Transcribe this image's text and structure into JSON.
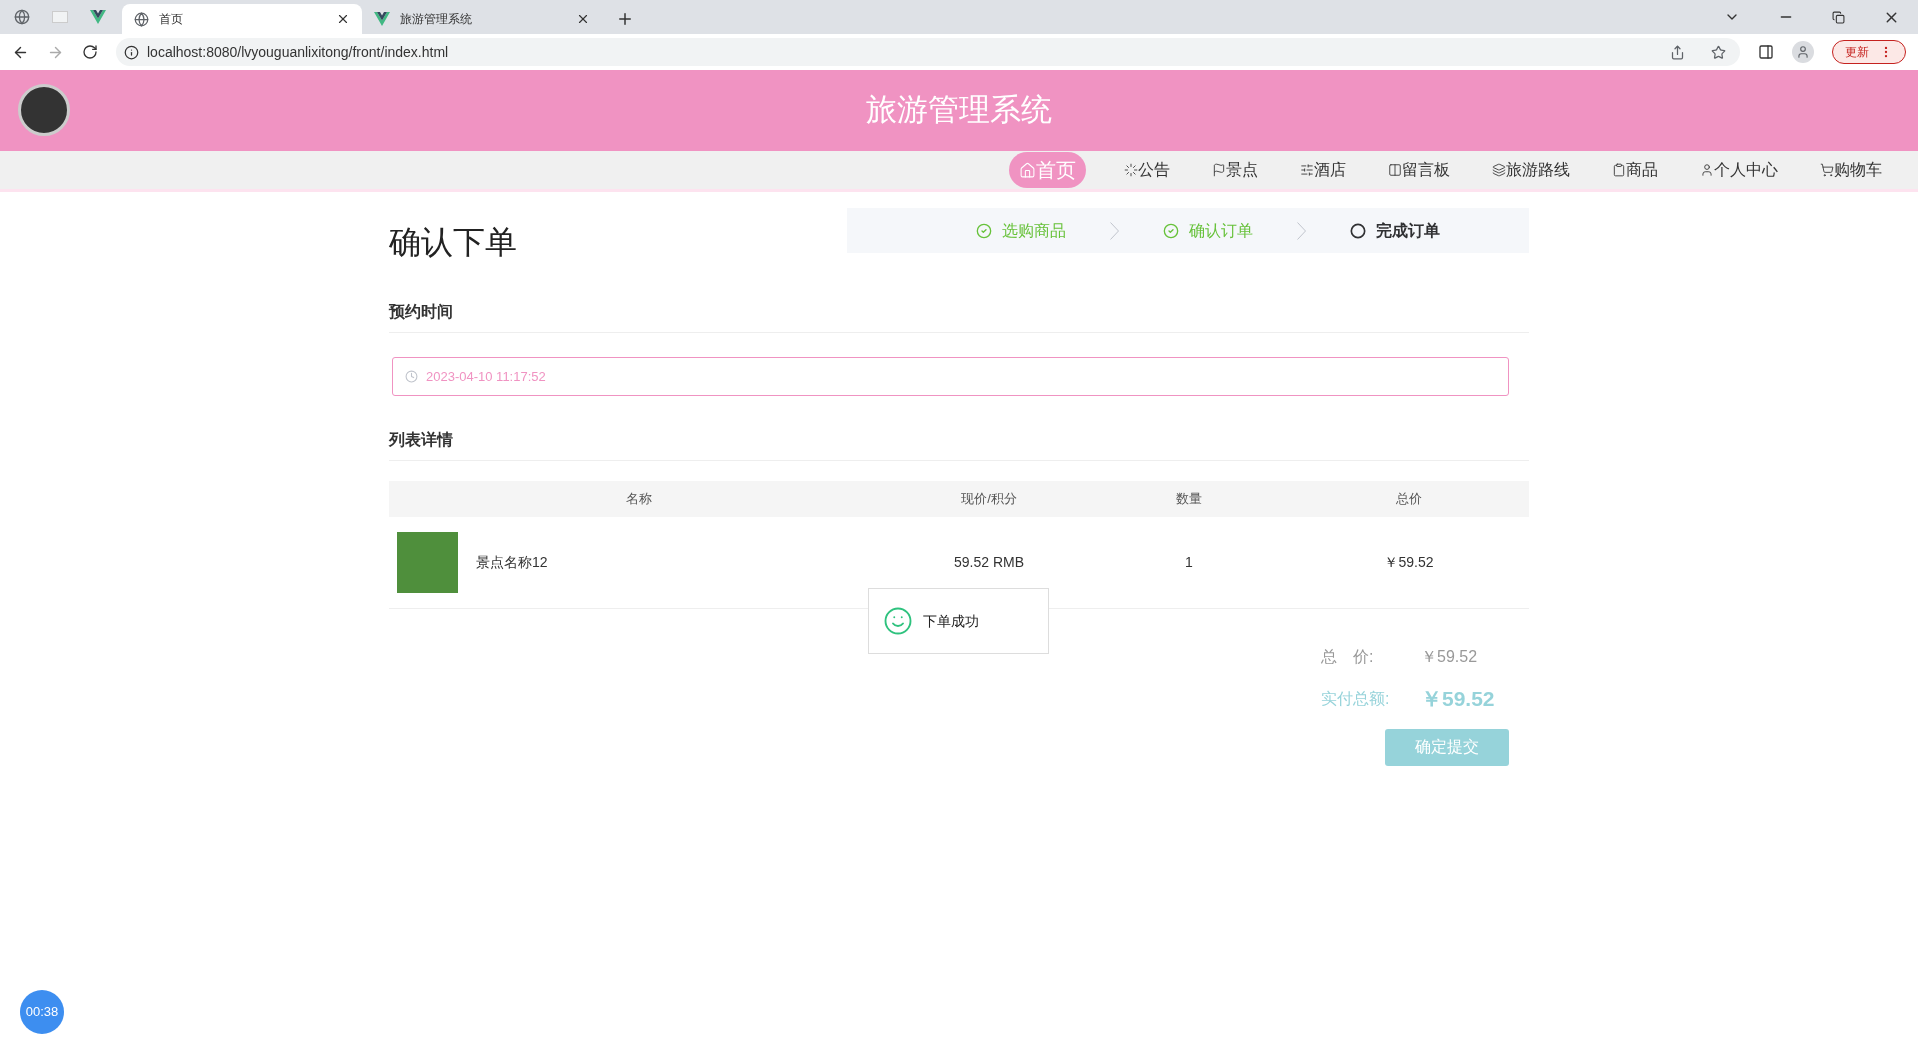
{
  "browser": {
    "tabs": [
      {
        "title": "首页",
        "selected": true
      },
      {
        "title": "旅游管理系统",
        "selected": false
      }
    ],
    "url": "localhost:8080/lvyouguanlixitong/front/index.html",
    "update_button": "更新"
  },
  "header": {
    "title": "旅游管理系统"
  },
  "nav": [
    {
      "label": "首页",
      "kind": "home",
      "selected": true
    },
    {
      "label": "公告",
      "kind": "notice",
      "selected": false
    },
    {
      "label": "景点",
      "kind": "flag",
      "selected": false
    },
    {
      "label": "酒店",
      "kind": "sliders",
      "selected": false
    },
    {
      "label": "留言板",
      "kind": "columns",
      "selected": false
    },
    {
      "label": "旅游路线",
      "kind": "layers",
      "selected": false
    },
    {
      "label": "商品",
      "kind": "clipboard",
      "selected": false
    },
    {
      "label": "个人中心",
      "kind": "user",
      "selected": false
    },
    {
      "label": "购物车",
      "kind": "cart",
      "selected": false
    }
  ],
  "page_title": "确认下单",
  "steps": [
    {
      "label": "选购商品",
      "done": true
    },
    {
      "label": "确认订单",
      "done": true
    },
    {
      "label": "完成订单",
      "done": false
    }
  ],
  "booking": {
    "title": "预约时间",
    "value": "2023-04-10 11:17:52"
  },
  "list": {
    "title": "列表详情",
    "columns": [
      "名称",
      "现价/积分",
      "数量",
      "总价"
    ],
    "rows": [
      {
        "name": "景点名称12",
        "price": "59.52 RMB",
        "quantity": "1",
        "total": "￥59.52"
      }
    ]
  },
  "toast": {
    "message": "下单成功"
  },
  "totals": {
    "total_label": "总　价:",
    "total_value": "￥59.52",
    "paid_label": "实付总额:",
    "paid_value": "￥59.52"
  },
  "submit_button": "确定提交",
  "timer": "00:38"
}
